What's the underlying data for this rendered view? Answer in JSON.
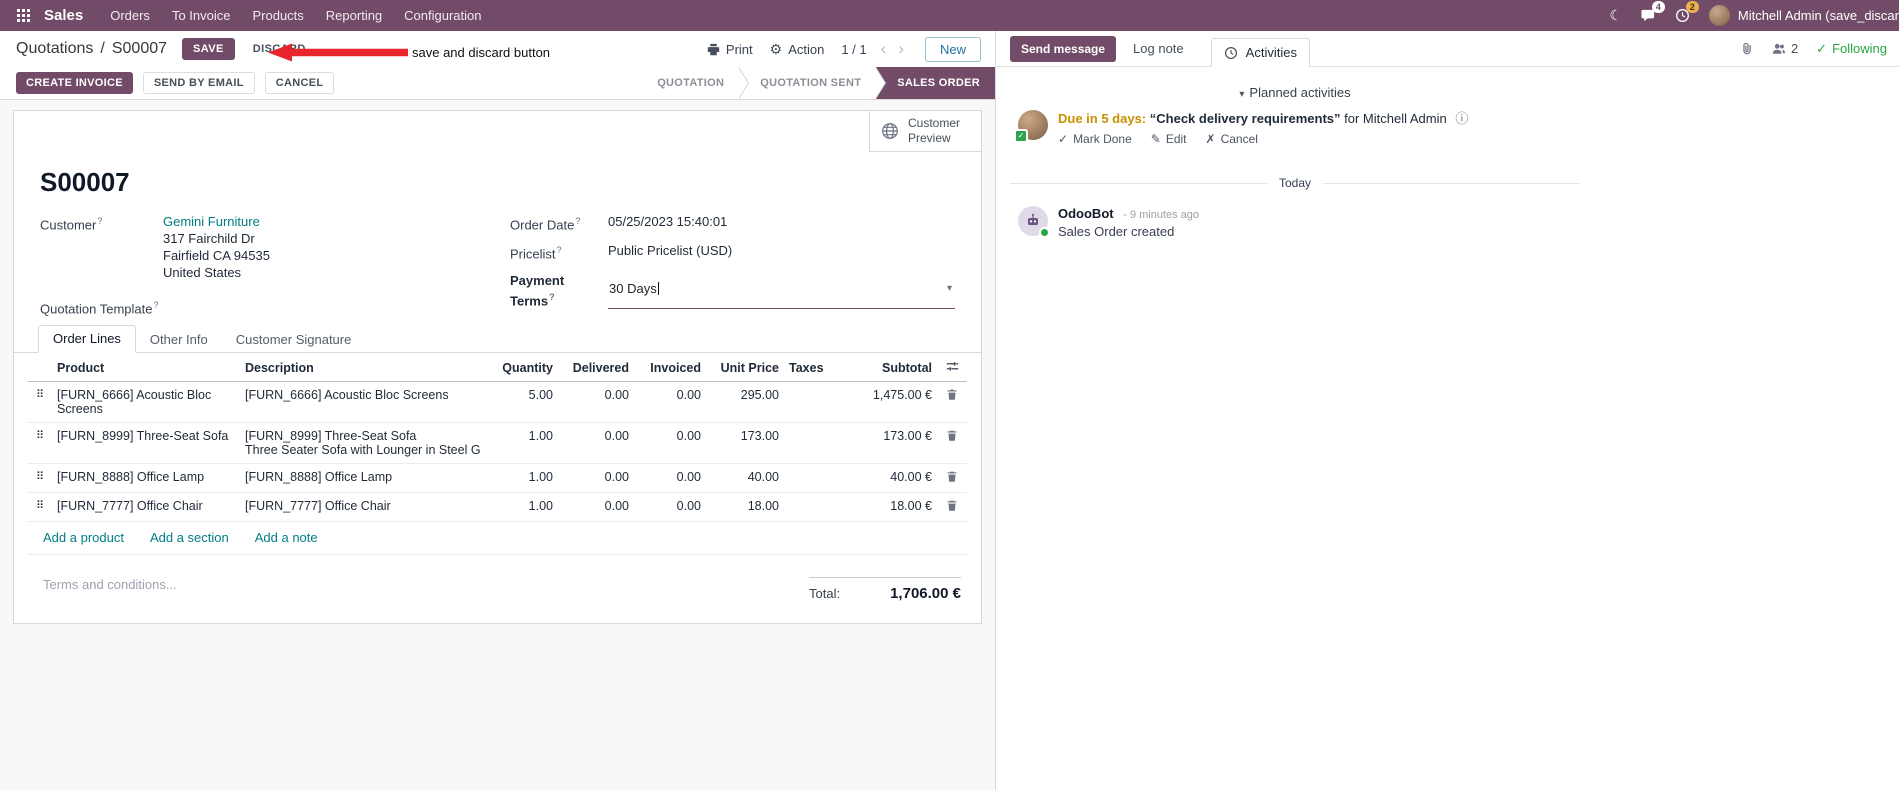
{
  "colors": {
    "brand": "#714B67",
    "link": "#017E84",
    "edited_value": "#2e6fd8",
    "annotation_red": "#e8242d",
    "success_green": "#28a745",
    "activity_due": "#c99000"
  },
  "navbar": {
    "app": "Sales",
    "menus": [
      "Orders",
      "To Invoice",
      "Products",
      "Reporting",
      "Configuration"
    ],
    "messages_badge": "4",
    "activities_badge": "2",
    "user": "Mitchell Admin (save_discar"
  },
  "control": {
    "breadcrumb": {
      "parent": "Quotations",
      "separator": "/",
      "current": "S00007"
    },
    "save": "SAVE",
    "discard": "DISCARD",
    "print": "Print",
    "action": "Action",
    "pager": "1 / 1",
    "new": "New"
  },
  "annotation": {
    "text": "save and discard button"
  },
  "statusbar": {
    "create_invoice": "CREATE INVOICE",
    "send_by_email": "SEND BY EMAIL",
    "cancel": "CANCEL",
    "steps": [
      "QUOTATION",
      "QUOTATION SENT",
      "SALES ORDER"
    ],
    "active_step": "SALES ORDER"
  },
  "sheet": {
    "preview_button": "Customer Preview",
    "title": "S00007",
    "hint": "?",
    "customer": {
      "label": "Customer",
      "name": "Gemini Furniture",
      "address": [
        "317 Fairchild Dr",
        "Fairfield CA 94535",
        "United States"
      ]
    },
    "quotation_template_label": "Quotation Template",
    "order_date": {
      "label": "Order Date",
      "value": "05/25/2023 15:40:01"
    },
    "pricelist": {
      "label": "Pricelist",
      "value": "Public Pricelist (USD)"
    },
    "payment_terms": {
      "label": "Payment Terms",
      "value": "30 Days"
    },
    "tabs": [
      "Order Lines",
      "Other Info",
      "Customer Signature"
    ]
  },
  "lines": {
    "columns": {
      "product": "Product",
      "description": "Description",
      "quantity": "Quantity",
      "delivered": "Delivered",
      "invoiced": "Invoiced",
      "unit_price": "Unit Price",
      "taxes": "Taxes",
      "subtotal": "Subtotal"
    },
    "rows": [
      {
        "product": "[FURN_6666] Acoustic Bloc Screens",
        "description": "[FURN_6666] Acoustic Bloc Screens",
        "quantity": "5.00",
        "delivered": "0.00",
        "invoiced": "0.00",
        "unit_price": "295.00",
        "taxes": "",
        "subtotal": "1,475.00 €"
      },
      {
        "product": "[FURN_8999] Three-Seat Sofa",
        "description": "[FURN_8999] Three-Seat Sofa",
        "description_line2": "Three Seater Sofa with Lounger in Steel Grey Colour",
        "quantity": "1.00",
        "delivered": "0.00",
        "invoiced": "0.00",
        "unit_price": "173.00",
        "taxes": "",
        "subtotal": "173.00 €"
      },
      {
        "product": "[FURN_8888] Office Lamp",
        "description": "[FURN_8888] Office Lamp",
        "quantity": "1.00",
        "delivered": "0.00",
        "invoiced": "0.00",
        "unit_price": "40.00",
        "taxes": "",
        "subtotal": "40.00 €"
      },
      {
        "product": "[FURN_7777] Office Chair",
        "description": "[FURN_7777] Office Chair",
        "quantity": "1.00",
        "delivered": "0.00",
        "invoiced": "0.00",
        "unit_price": "18.00",
        "taxes": "",
        "subtotal": "18.00 €"
      }
    ],
    "add_product": "Add a product",
    "add_section": "Add a section",
    "add_note": "Add a note",
    "terms_placeholder": "Terms and conditions...",
    "total_label": "Total:",
    "total_value": "1,706.00 €"
  },
  "chatter": {
    "send_message": "Send message",
    "log_note": "Log note",
    "activities": "Activities",
    "followers_count": "2",
    "following": "Following",
    "planned_header": "Planned activities",
    "activity": {
      "due": "Due in 5 days:",
      "summary": "“Check delivery requirements”",
      "assignee": "for Mitchell Admin",
      "mark_done": "Mark Done",
      "edit": "Edit",
      "cancel": "Cancel"
    },
    "today": "Today",
    "message": {
      "author": "OdooBot",
      "time": "- 9 minutes ago",
      "body": "Sales Order created"
    }
  }
}
